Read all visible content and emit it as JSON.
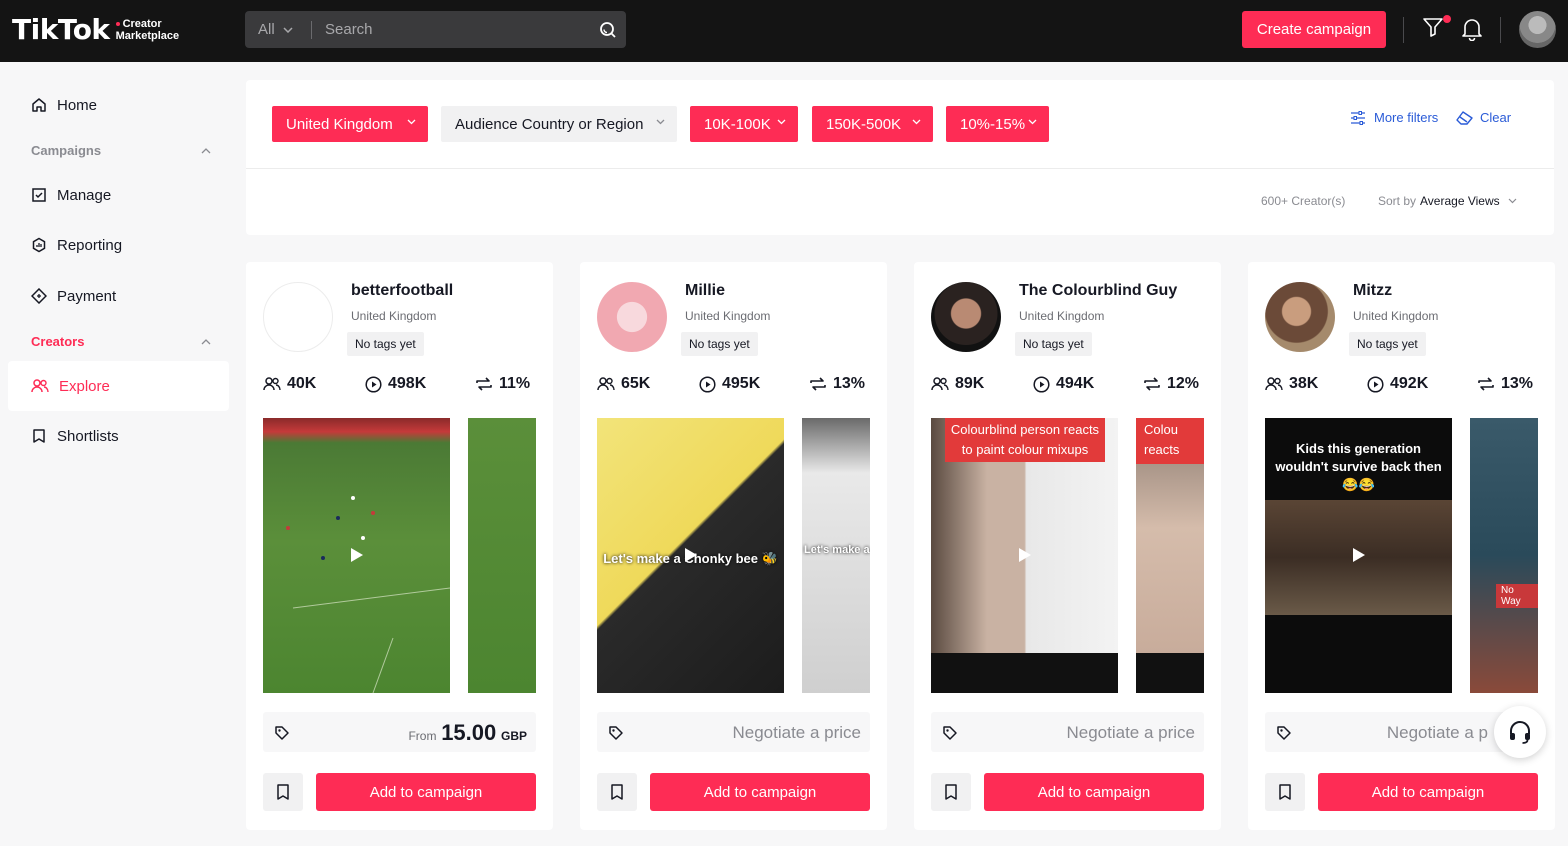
{
  "brand": {
    "logo": "TikTok",
    "sub_line1": "Creator",
    "sub_line2": "Marketplace"
  },
  "header": {
    "search_scope": "All",
    "search_placeholder": "Search",
    "create_label": "Create campaign"
  },
  "sidebar": {
    "home": "Home",
    "campaigns_section": "Campaigns",
    "manage": "Manage",
    "reporting": "Reporting",
    "payment": "Payment",
    "creators_section": "Creators",
    "explore": "Explore",
    "shortlists": "Shortlists"
  },
  "filters": {
    "chips": [
      "United Kingdom",
      "Audience Country or Region",
      "10K-100K",
      "150K-500K",
      "10%-15%"
    ],
    "more_filters": "More filters",
    "clear": "Clear",
    "count": "600+ Creator(s)",
    "sort_prefix": "Sort by",
    "sort_value": "Average Views"
  },
  "creators": [
    {
      "name": "betterfootball",
      "country": "United Kingdom",
      "tag": "No tags yet",
      "followers": "40K",
      "views": "498K",
      "engagement": "11%",
      "price_from": "From",
      "price_amount": "15.00",
      "price_currency": "GBP",
      "video_caption": "",
      "add_label": "Add to campaign"
    },
    {
      "name": "Millie",
      "country": "United Kingdom",
      "tag": "No tags yet",
      "followers": "65K",
      "views": "495K",
      "engagement": "13%",
      "price_text": "Negotiate a price",
      "video_caption": "Let's make a Chonky bee 🐝",
      "video2_caption": "Let's make a",
      "add_label": "Add to campaign"
    },
    {
      "name": "The Colourblind Guy",
      "country": "United Kingdom",
      "tag": "No tags yet",
      "followers": "89K",
      "views": "494K",
      "engagement": "12%",
      "price_text": "Negotiate a price",
      "video_caption": "Colourblind person reacts to paint colour mixups",
      "video2_caption": "Colou reacts",
      "add_label": "Add to campaign"
    },
    {
      "name": "Mitzz",
      "country": "United Kingdom",
      "tag": "No tags yet",
      "followers": "38K",
      "views": "492K",
      "engagement": "13%",
      "price_text": "Negotiate a p",
      "video_caption": "Kids this generation wouldn't survive back then 😂😂",
      "video2_caption": "No Way",
      "add_label": "Add to campaign"
    }
  ],
  "colors": {
    "accent": "#fe2c55",
    "topbar": "#141414",
    "link": "#2a5bd7"
  }
}
